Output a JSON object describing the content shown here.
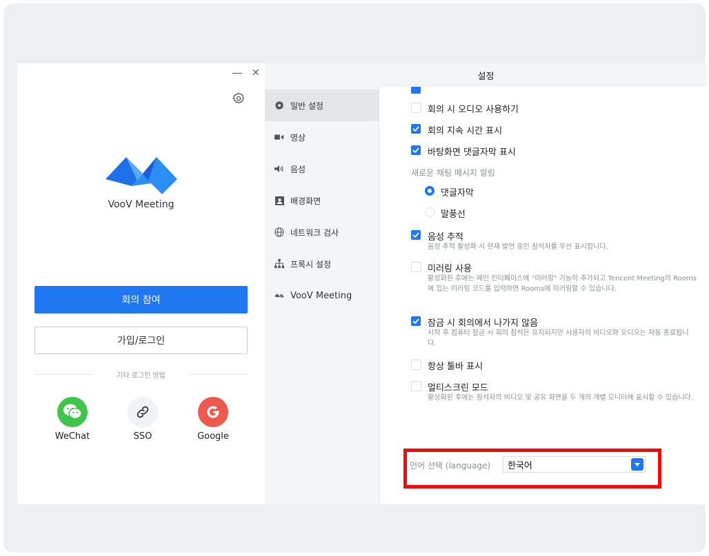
{
  "login_panel": {
    "minimize_icon": "—",
    "close_icon": "✕",
    "app_name": "VooV Meeting",
    "join_button": "회의 참여",
    "login_button": "가입/로그인",
    "other_login_label": "기타 로그인 방법",
    "social": [
      {
        "label": "WeChat",
        "icon": "wechat-icon",
        "color": "#3fc54a"
      },
      {
        "label": "SSO",
        "icon": "link-icon",
        "color": "#f1f2f4"
      },
      {
        "label": "Google",
        "icon": "google-icon",
        "color": "#ec5a4d"
      }
    ]
  },
  "settings": {
    "title": "설정",
    "nav": [
      {
        "label": "일반 설정",
        "icon": "gear-icon",
        "active": true
      },
      {
        "label": "영상",
        "icon": "video-icon"
      },
      {
        "label": "음성",
        "icon": "speaker-icon"
      },
      {
        "label": "배경화면",
        "icon": "background-icon"
      },
      {
        "label": "네트워크 검사",
        "icon": "globe-icon"
      },
      {
        "label": "프록시 설정",
        "icon": "network-icon"
      },
      {
        "label": "VooV Meeting",
        "icon": "voov-logo-icon"
      }
    ],
    "options": {
      "audio_on_join": {
        "label": "회의 시 오디오 사용하기",
        "checked": false
      },
      "show_duration": {
        "label": "회의 지속 시간 표시",
        "checked": true
      },
      "desktop_danmaku": {
        "label": "바탕화면 댓글자막 표시",
        "checked": true
      },
      "chat_section": "새로운 채팅 메시지 알림",
      "radio_danmaku": "댓글자막",
      "radio_bubble": "말풍선",
      "voice_tracking": {
        "label": "음성 추적",
        "checked": true,
        "desc": "음성 추적 활성화 시 현재 발언 중인 참석자를 우선 표시합니다."
      },
      "mirroring": {
        "label": "미러링 사용",
        "checked": false,
        "desc": "활성화된 후에는 메인 인터페이스에 \"미러링\" 기능이 추가되고 Tencent Meeting의 Rooms에 있는 미러링 코드를 입력하면 Rooms에 미러링할 수 있습니다."
      },
      "lock_stay": {
        "label": "잠금 시 회의에서 나가지 않음",
        "checked": true,
        "desc": "시작 후 컴퓨터 잠금 시 회의 참석은 유지되지만 사용자의 비디오와 오디오는 자동 종료됩니다."
      },
      "toolbar": {
        "label": "항상 툴바 표시",
        "checked": false
      },
      "multiscreen": {
        "label": "멀티스크린 모드",
        "checked": false,
        "desc": "활성화된 후에는 참석자의 비디오 및 공유 화면을 두 개의 개별 모니터에 표시할 수 있습니다."
      }
    },
    "language": {
      "label": "언어 선택 (language)",
      "value": "한국어"
    }
  },
  "colors": {
    "accent": "#1f78f2",
    "highlight": "#f50a0a"
  }
}
